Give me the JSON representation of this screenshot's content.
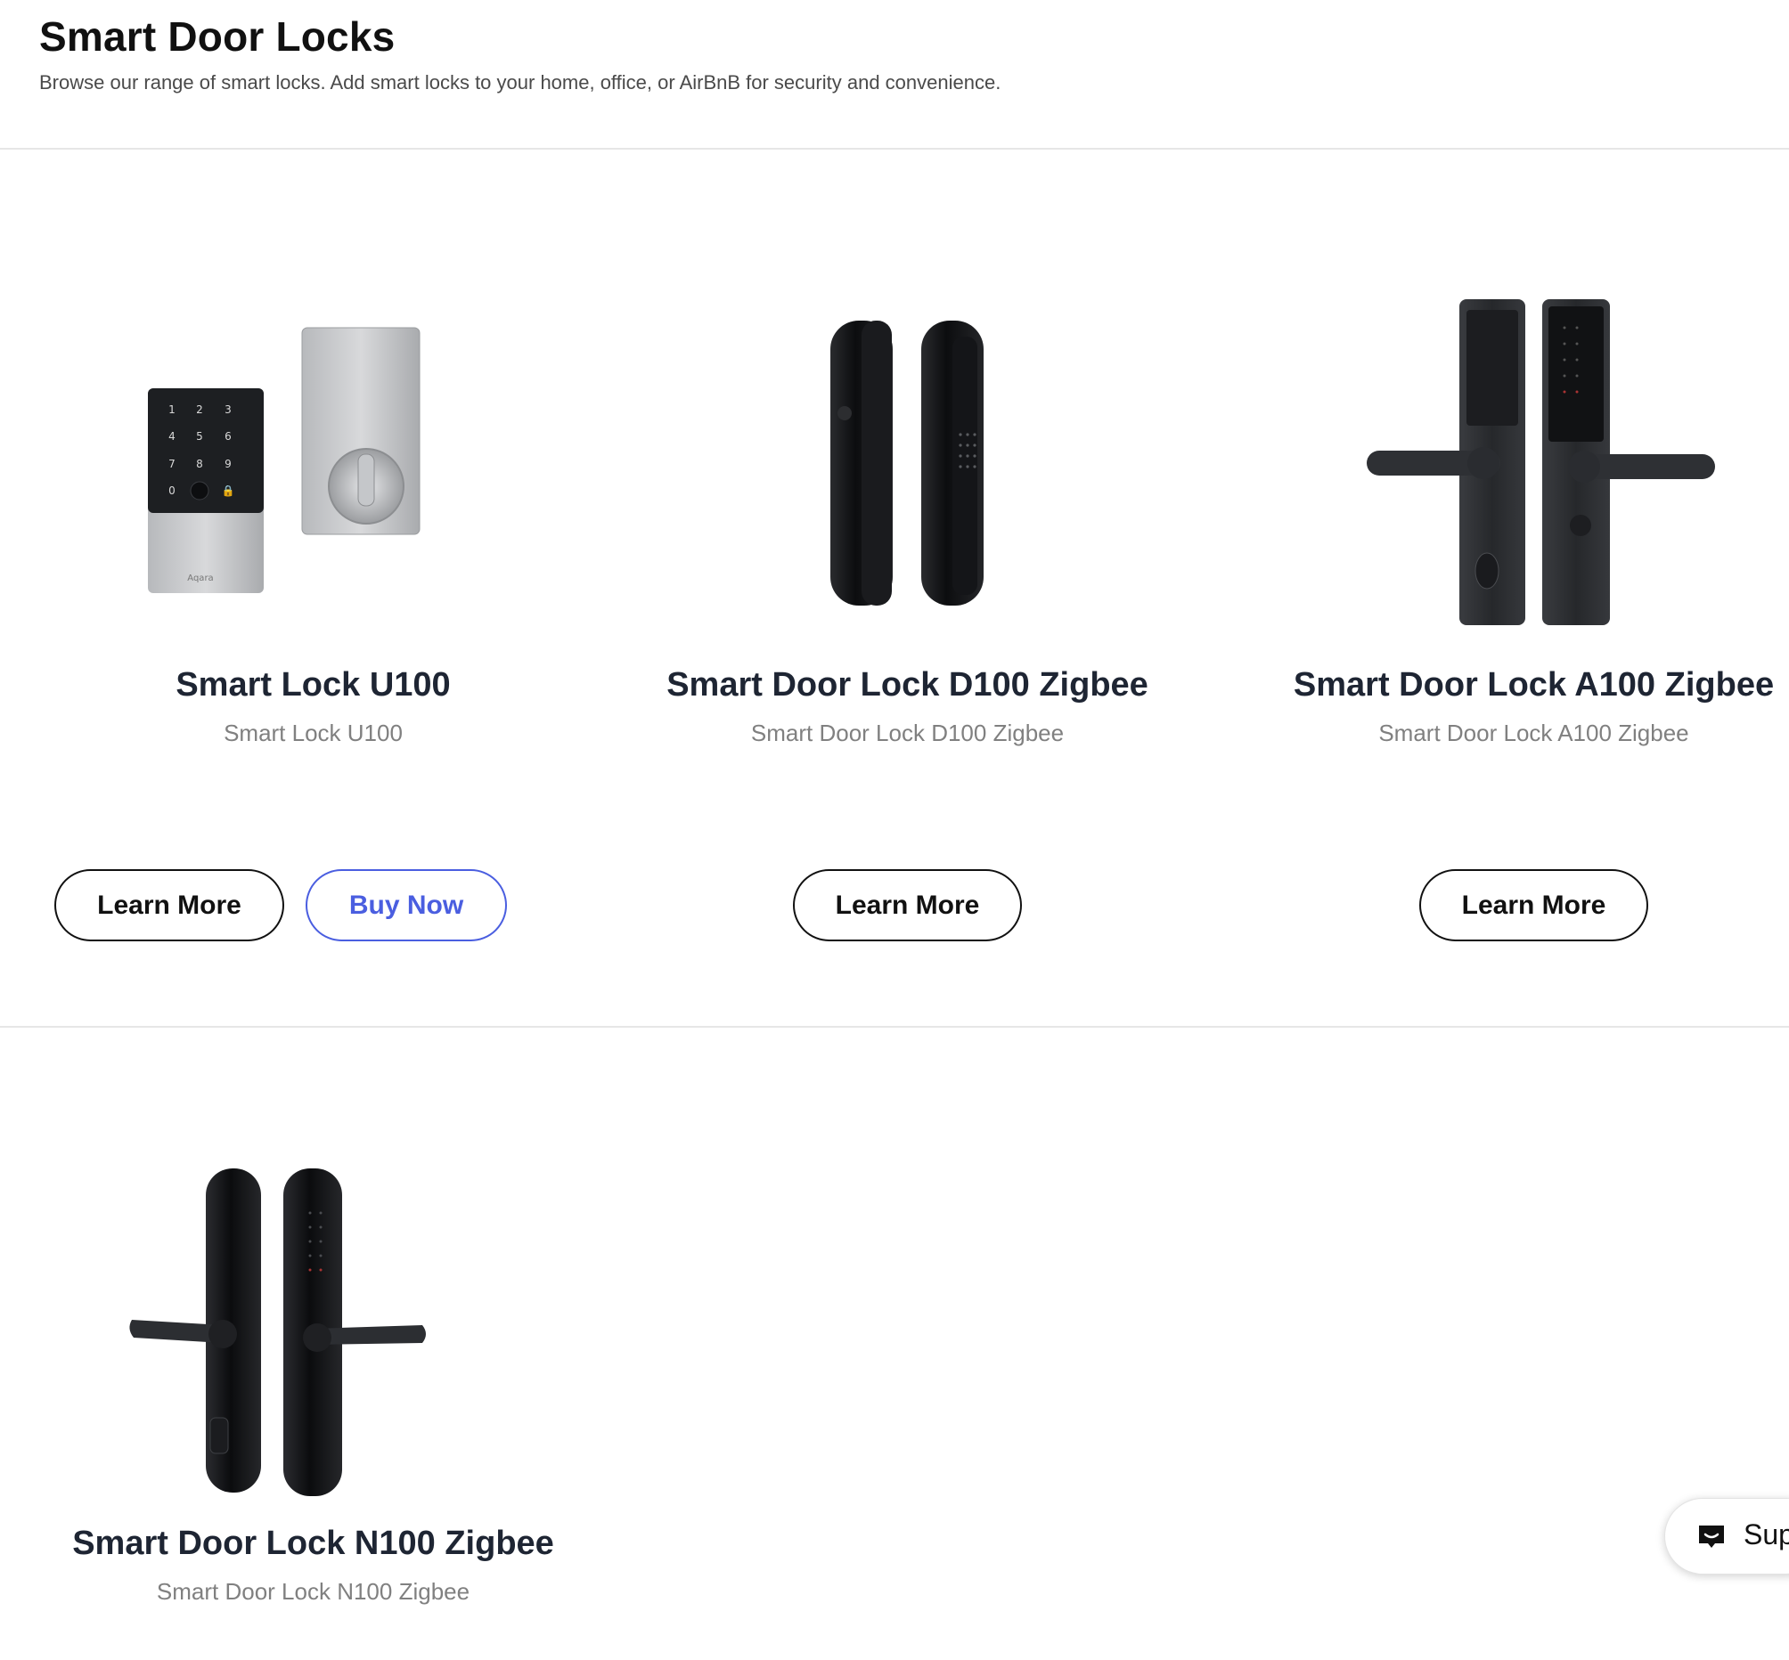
{
  "header": {
    "title": "Smart Door Locks",
    "subtitle": "Browse our range of smart locks. Add smart locks to your home, office, or AirBnB for security and convenience."
  },
  "products": [
    {
      "name": "Smart Lock U100",
      "subtitle": "Smart Lock U100",
      "image_icon": "keypad-deadbolt-lock-image",
      "buttons": {
        "learn_more": "Learn More",
        "buy_now": "Buy Now"
      }
    },
    {
      "name": "Smart Door Lock D100 Zigbee",
      "subtitle": "Smart Door Lock D100 Zigbee",
      "image_icon": "push-pull-lock-image",
      "buttons": {
        "learn_more": "Learn More"
      }
    },
    {
      "name": "Smart Door Lock A100 Zigbee",
      "subtitle": "Smart Door Lock A100 Zigbee",
      "image_icon": "lever-handle-lock-image",
      "buttons": {
        "learn_more": "Learn More"
      }
    },
    {
      "name": "Smart Door Lock N100 Zigbee",
      "subtitle": "Smart Door Lock N100 Zigbee",
      "image_icon": "lever-handle-lock-image",
      "buttons": {}
    }
  ],
  "support": {
    "label": "Sup",
    "icon": "chat-icon"
  },
  "colors": {
    "buy_accent": "#4a5ee0",
    "text_dark": "#1e2533",
    "text_muted": "#808080"
  }
}
